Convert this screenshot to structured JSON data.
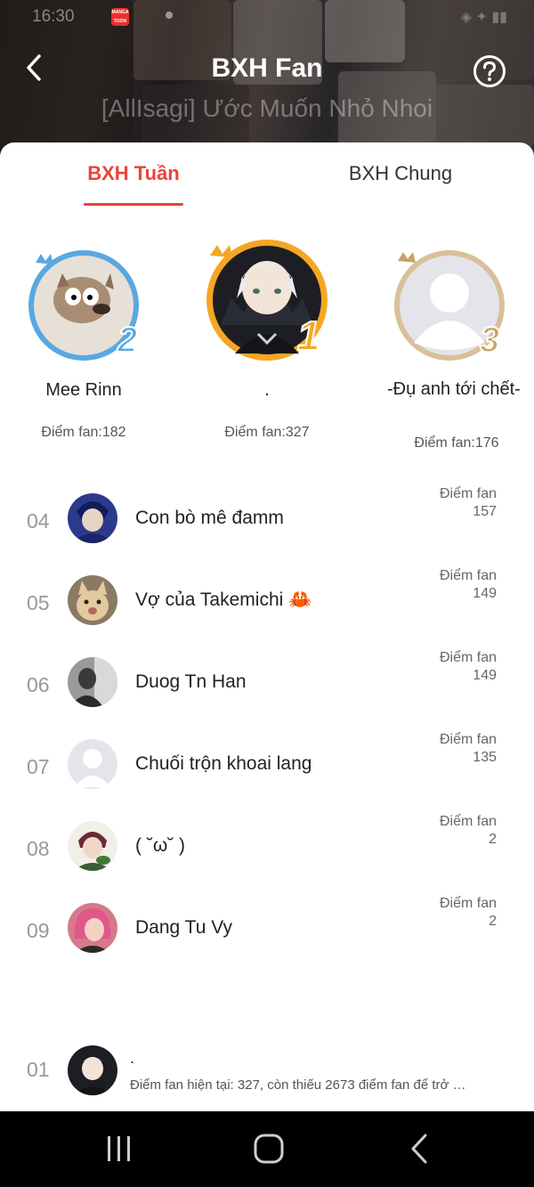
{
  "status_bar": {
    "time": "16:30",
    "app_badge": "MANGA TOON"
  },
  "header": {
    "title": "BXH Fan",
    "subtitle": "[AllIsagi] Ước Muốn Nhỏ Nhoi"
  },
  "tabs": [
    {
      "label": "BXH Tuần",
      "active": true
    },
    {
      "label": "BXH Chung",
      "active": false
    }
  ],
  "colors": {
    "accent": "#e8453c",
    "gold": "#f5a623",
    "silver": "#5aa8e0",
    "bronze": "#c8a266"
  },
  "podium": [
    {
      "place": 2,
      "name": "Mee Rinn",
      "score": "Điểm fan:182",
      "badge": "2"
    },
    {
      "place": 1,
      "name": ".",
      "score": "Điểm fan:327",
      "badge": "1"
    },
    {
      "place": 3,
      "name": "-Đụ anh tới chết-",
      "score": "Điểm fan:176",
      "badge": "3"
    }
  ],
  "list": [
    {
      "rank": "04",
      "name": "Con bò mê đamm",
      "score_label": "Điểm fan",
      "score": "157",
      "avatar_icon": "anime-avatar-icon"
    },
    {
      "rank": "05",
      "name": "Vợ của Takemichi 🦀",
      "score_label": "Điểm fan",
      "score": "149",
      "avatar_icon": "cat-avatar-icon"
    },
    {
      "rank": "06",
      "name": "Duog Tn Han",
      "score_label": "Điểm fan",
      "score": "149",
      "avatar_icon": "photo-avatar-icon"
    },
    {
      "rank": "07",
      "name": "Chuối trộn khoai lang",
      "score_label": "Điểm fan",
      "score": "135",
      "avatar_icon": "default-avatar-icon"
    },
    {
      "rank": "08",
      "name": "( ˘ω˘ )",
      "score_label": "Điểm fan",
      "score": "2",
      "avatar_icon": "anime-avatar-icon"
    },
    {
      "rank": "09",
      "name": "Dang Tu Vy",
      "score_label": "Điểm fan",
      "score": "2",
      "avatar_icon": "photo-avatar-icon"
    }
  ],
  "me": {
    "rank": "01",
    "name": ".",
    "desc": "Điểm fan hiện tại: 327, còn thiếu 2673 điểm fan để trở …"
  },
  "nav": {
    "recents_icon": "recents-icon",
    "home_icon": "home-icon",
    "back_icon": "back-icon"
  }
}
